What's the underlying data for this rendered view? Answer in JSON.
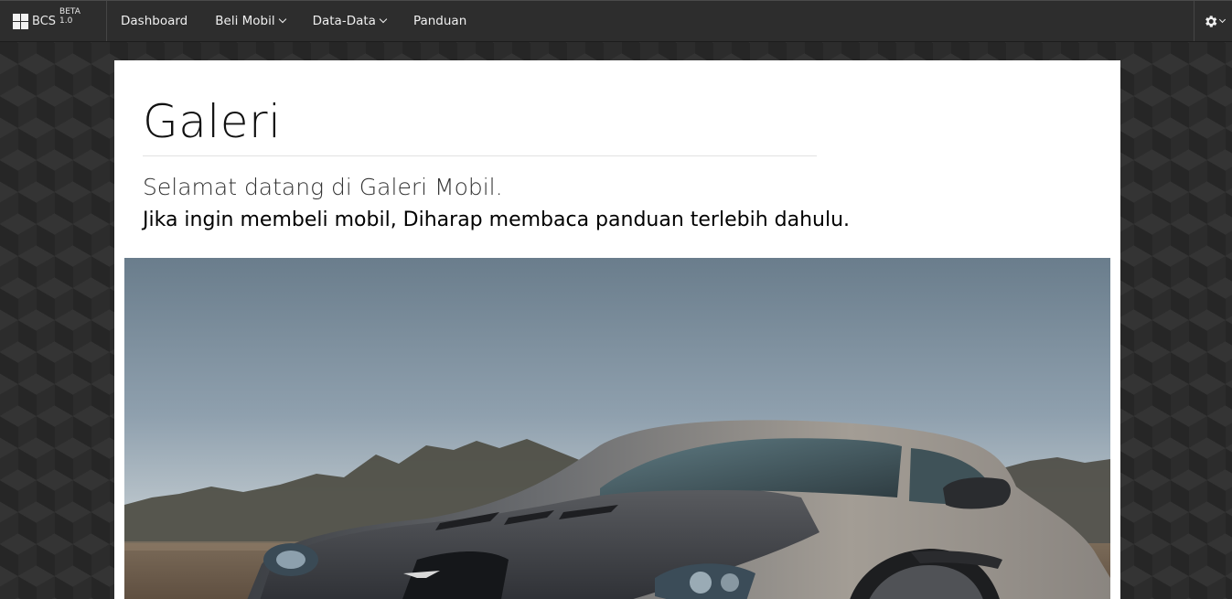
{
  "navbar": {
    "brand": "BCS",
    "beta": "BETA 1.0",
    "items": [
      {
        "label": "Dashboard",
        "dropdown": false
      },
      {
        "label": "Beli Mobil",
        "dropdown": true
      },
      {
        "label": "Data-Data",
        "dropdown": true
      },
      {
        "label": "Panduan",
        "dropdown": false
      }
    ],
    "settings_icon": "gear-icon"
  },
  "main": {
    "title": "Galeri",
    "welcome": "Selamat datang di Galeri Mobil.",
    "instruction": "Jika ingin membeli mobil, Diharap membaca panduan terlebih dahulu.",
    "photo": "silver sports car on a field"
  },
  "colors": {
    "navbar": "#2d2d2d",
    "background": "#2c2c2c",
    "card": "#ffffff"
  }
}
